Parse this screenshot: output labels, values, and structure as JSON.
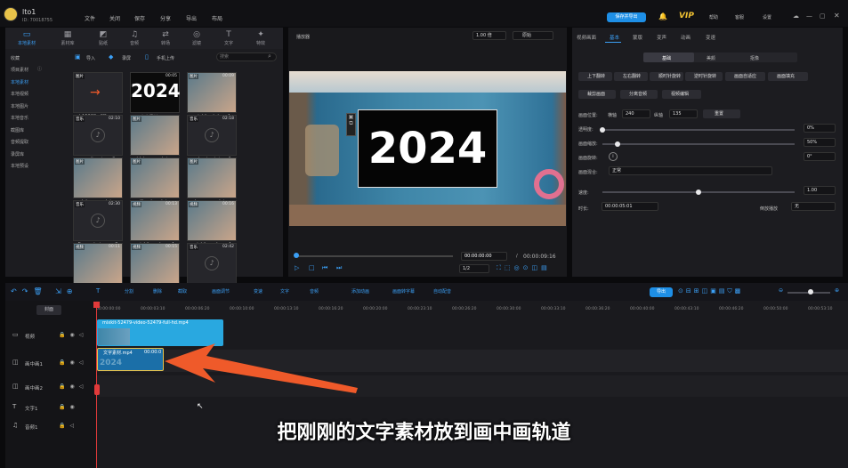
{
  "topbar": {
    "app_name": "lto1",
    "user_id": "ID: 70018755",
    "menus": [
      "文件",
      "关闭",
      "保存",
      "分享",
      "导出",
      "布局"
    ],
    "export_label": "保存并导出",
    "vip": "VIP",
    "right": [
      "帮助",
      "客服",
      "设置"
    ]
  },
  "toolbar": {
    "items": [
      {
        "label": "本地素材",
        "icon": "folder-icon"
      },
      {
        "label": "素材库",
        "icon": "library-icon"
      },
      {
        "label": "贴纸",
        "icon": "sticker-icon"
      },
      {
        "label": "音频",
        "icon": "music-icon"
      },
      {
        "label": "转场",
        "icon": "transition-icon"
      },
      {
        "label": "滤镜",
        "icon": "filter-icon"
      },
      {
        "label": "文字",
        "icon": "text-icon"
      },
      {
        "label": "特效",
        "icon": "effects-icon"
      }
    ]
  },
  "sidebar": {
    "items": [
      "收藏",
      "项目素材",
      "本地素材",
      "本地视频",
      "本地图片",
      "本地音乐",
      "截图库",
      "音频提取",
      "录屏库",
      "本地预设"
    ]
  },
  "media": {
    "import": "导入",
    "record": "录屏",
    "phone": "手机上传",
    "search_placeholder": "搜索",
    "items": [
      {
        "name": "b15338...SD.png",
        "tag": "图片",
        "dur": ""
      },
      {
        "name": "文字素材.mp4",
        "tag": "",
        "dur": "00:05",
        "text": "2024"
      },
      {
        "name": "mixkit-...hd.mp4",
        "tag": "图片",
        "dur": "00:09"
      },
      {
        "name": "magiks...ir.mp3",
        "tag": "音乐",
        "dur": "02:10"
      },
      {
        "name": "blake-c...ash.jpg",
        "tag": "图片",
        "dur": ""
      },
      {
        "name": "upbeat-...tai.mp3",
        "tag": "音乐",
        "dur": "02:18"
      },
      {
        "name": "aleksan...ash.jpg",
        "tag": "图片",
        "dur": ""
      },
      {
        "name": "allie-el...ash.jpg",
        "tag": "图片",
        "dur": ""
      },
      {
        "name": "dar-sea...ash.jpg",
        "tag": "图片",
        "dur": ""
      },
      {
        "name": "Energet...ion.mp3",
        "tag": "音乐",
        "dur": "02:30"
      },
      {
        "name": "mixkit-...ady.mp4",
        "tag": "视频",
        "dur": "00:13"
      },
      {
        "name": "mixkit-...ady.mp4",
        "tag": "视频",
        "dur": "00:16"
      },
      {
        "name": "",
        "tag": "视频",
        "dur": "00:11"
      },
      {
        "name": "",
        "tag": "视频",
        "dur": "00:15"
      },
      {
        "name": "",
        "tag": "音乐",
        "dur": "02:42"
      }
    ]
  },
  "preview": {
    "title": "播放器",
    "zoom": "1.00 倍",
    "ratio": "原始",
    "overlay_text": "2024",
    "time_current": "00:00:00:00",
    "time_sep": "/",
    "time_total": "00:00:09:16",
    "speed": "1/2"
  },
  "props": {
    "tabs": [
      "视频画面",
      "基本",
      "蒙版",
      "变声",
      "动画",
      "变速"
    ],
    "subtabs": [
      "基础",
      "美颜",
      "抠像"
    ],
    "buttons": [
      "上下翻转",
      "左右翻转",
      "顺时针旋转",
      "逆时针旋转",
      "画面自适应",
      "画面填充",
      "裁剪画面",
      "分离音频",
      "视频编辑"
    ],
    "pos_label": "画面位置:",
    "x_label": "横轴",
    "x_value": "240",
    "y_label": "纵轴",
    "y_value": "135",
    "reset": "重置",
    "opacity_label": "透明度:",
    "opacity_value": "0%",
    "opacity_level": 0,
    "scale_label": "画面缩放:",
    "scale_value": "50%",
    "scale_level": 0.5,
    "rotate_label": "画面旋转:",
    "rotate_value": "0°",
    "blend_label": "画面混合:",
    "blend_value": "正常",
    "speed_label": "速度:",
    "speed_value": "1.00",
    "speed_level": 0.5,
    "duration_label": "时长:",
    "duration_value": "00:00:05:01",
    "flip_label": "倒放播放",
    "flip_value": "无"
  },
  "timeline": {
    "export_btn": "导出",
    "cover": "封面",
    "tools": [
      "分割",
      "删除",
      "截取",
      "画面调节",
      "变速",
      "文字",
      "音频",
      "添加动画",
      "画面转字幕",
      "自动配音"
    ],
    "ticks": [
      "00:00:00:00",
      "00:00:03:10",
      "00:00:06:20",
      "00:00:10:00",
      "00:00:13:10",
      "00:00:16:20",
      "00:00:20:00",
      "00:00:23:10",
      "00:00:26:20",
      "00:00:30:00",
      "00:00:33:10",
      "00:00:36:20",
      "00:00:40:00",
      "00:00:43:10",
      "00:00:46:20",
      "00:00:50:00",
      "00:00:53:10"
    ],
    "tracks": [
      {
        "label": "视频",
        "icon": "film-icon"
      },
      {
        "label": "画中画1",
        "icon": "pip-icon"
      },
      {
        "label": "画中画2",
        "icon": "pip-icon"
      },
      {
        "label": "文字1",
        "icon": "text-icon"
      },
      {
        "label": "音频1",
        "icon": "music-icon"
      }
    ],
    "video_clip": "mixkit-52479-video-52479-full-hd.mp4",
    "pip_clip": "文字素材.mp4",
    "pip_clip_dur": "00:00:0",
    "pip_text": "2024"
  },
  "subtitle": "把刚刚的文字素材放到画中画轨道",
  "colors": {
    "accent": "#1e8fe6",
    "clip": "#29a8e0",
    "arrow": "#ef5a2a"
  }
}
